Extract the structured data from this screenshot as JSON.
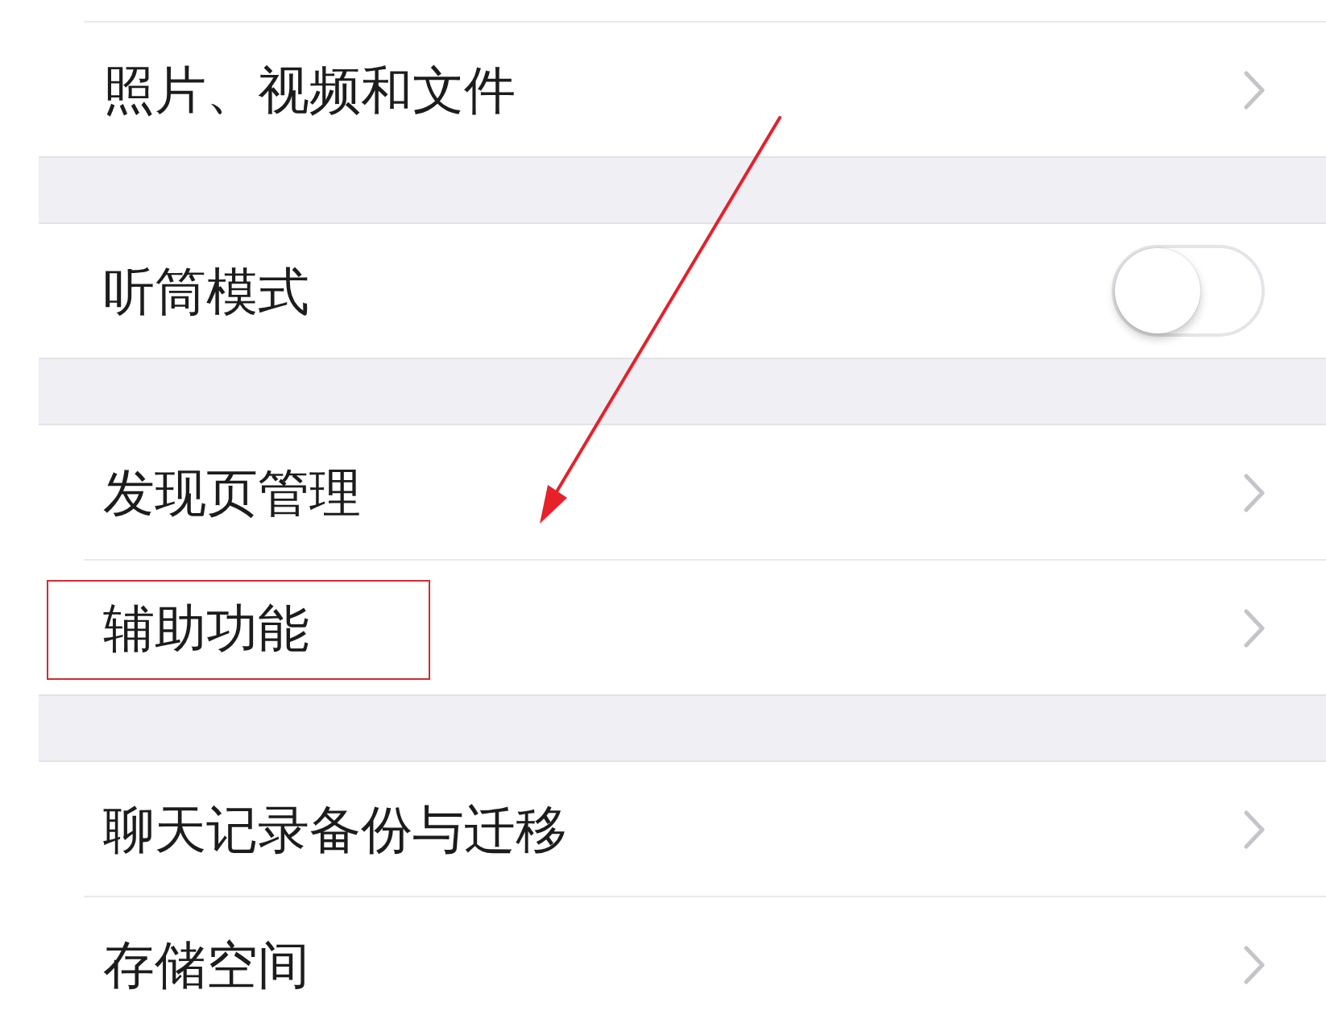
{
  "sections": [
    {
      "rows": [
        {
          "kind": "link",
          "label": "照片、视频和文件",
          "highlighted": false
        }
      ]
    },
    {
      "rows": [
        {
          "kind": "toggle",
          "label": "听筒模式",
          "on": false,
          "highlighted": false
        }
      ]
    },
    {
      "rows": [
        {
          "kind": "link",
          "label": "发现页管理",
          "highlighted": false
        },
        {
          "kind": "link",
          "label": "辅助功能",
          "highlighted": true
        }
      ]
    },
    {
      "rows": [
        {
          "kind": "link",
          "label": "聊天记录备份与迁移",
          "highlighted": false
        },
        {
          "kind": "link",
          "label": "存储空间",
          "highlighted": false
        }
      ]
    }
  ]
}
